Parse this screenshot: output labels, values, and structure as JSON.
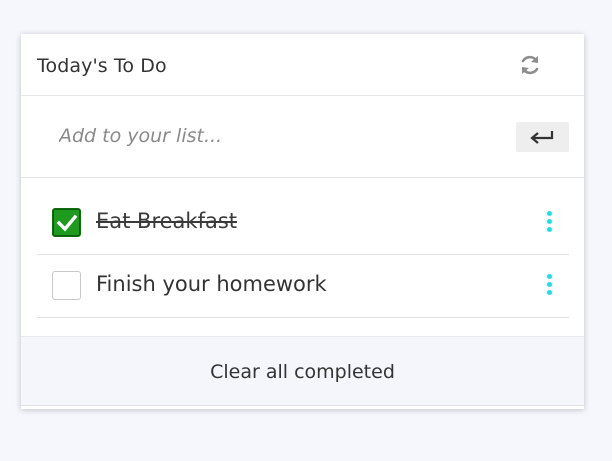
{
  "header": {
    "title": "Today's To Do",
    "refresh_icon": "refresh-icon"
  },
  "add": {
    "placeholder": "Add to your list...",
    "value": "",
    "enter_icon": "enter-icon"
  },
  "items": [
    {
      "text": "Eat Breakfast",
      "completed": true
    },
    {
      "text": "Finish your homework",
      "completed": false
    }
  ],
  "footer": {
    "clear_label": "Clear all completed"
  },
  "colors": {
    "checked": "#1e9a1e",
    "kebab": "#19e1ec",
    "background": "#f6f7fd"
  }
}
